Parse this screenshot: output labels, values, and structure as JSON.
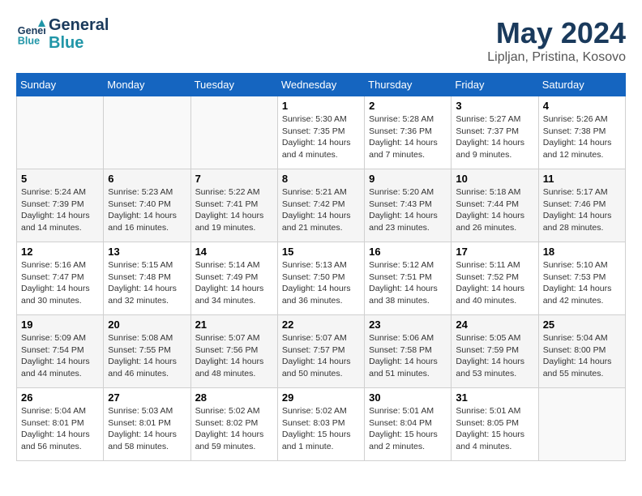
{
  "header": {
    "logo_line1": "General",
    "logo_line2": "Blue",
    "title": "May 2024",
    "subtitle": "Lipljan, Pristina, Kosovo"
  },
  "weekdays": [
    "Sunday",
    "Monday",
    "Tuesday",
    "Wednesday",
    "Thursday",
    "Friday",
    "Saturday"
  ],
  "weeks": [
    [
      {
        "day": "",
        "info": ""
      },
      {
        "day": "",
        "info": ""
      },
      {
        "day": "",
        "info": ""
      },
      {
        "day": "1",
        "info": "Sunrise: 5:30 AM\nSunset: 7:35 PM\nDaylight: 14 hours\nand 4 minutes."
      },
      {
        "day": "2",
        "info": "Sunrise: 5:28 AM\nSunset: 7:36 PM\nDaylight: 14 hours\nand 7 minutes."
      },
      {
        "day": "3",
        "info": "Sunrise: 5:27 AM\nSunset: 7:37 PM\nDaylight: 14 hours\nand 9 minutes."
      },
      {
        "day": "4",
        "info": "Sunrise: 5:26 AM\nSunset: 7:38 PM\nDaylight: 14 hours\nand 12 minutes."
      }
    ],
    [
      {
        "day": "5",
        "info": "Sunrise: 5:24 AM\nSunset: 7:39 PM\nDaylight: 14 hours\nand 14 minutes."
      },
      {
        "day": "6",
        "info": "Sunrise: 5:23 AM\nSunset: 7:40 PM\nDaylight: 14 hours\nand 16 minutes."
      },
      {
        "day": "7",
        "info": "Sunrise: 5:22 AM\nSunset: 7:41 PM\nDaylight: 14 hours\nand 19 minutes."
      },
      {
        "day": "8",
        "info": "Sunrise: 5:21 AM\nSunset: 7:42 PM\nDaylight: 14 hours\nand 21 minutes."
      },
      {
        "day": "9",
        "info": "Sunrise: 5:20 AM\nSunset: 7:43 PM\nDaylight: 14 hours\nand 23 minutes."
      },
      {
        "day": "10",
        "info": "Sunrise: 5:18 AM\nSunset: 7:44 PM\nDaylight: 14 hours\nand 26 minutes."
      },
      {
        "day": "11",
        "info": "Sunrise: 5:17 AM\nSunset: 7:46 PM\nDaylight: 14 hours\nand 28 minutes."
      }
    ],
    [
      {
        "day": "12",
        "info": "Sunrise: 5:16 AM\nSunset: 7:47 PM\nDaylight: 14 hours\nand 30 minutes."
      },
      {
        "day": "13",
        "info": "Sunrise: 5:15 AM\nSunset: 7:48 PM\nDaylight: 14 hours\nand 32 minutes."
      },
      {
        "day": "14",
        "info": "Sunrise: 5:14 AM\nSunset: 7:49 PM\nDaylight: 14 hours\nand 34 minutes."
      },
      {
        "day": "15",
        "info": "Sunrise: 5:13 AM\nSunset: 7:50 PM\nDaylight: 14 hours\nand 36 minutes."
      },
      {
        "day": "16",
        "info": "Sunrise: 5:12 AM\nSunset: 7:51 PM\nDaylight: 14 hours\nand 38 minutes."
      },
      {
        "day": "17",
        "info": "Sunrise: 5:11 AM\nSunset: 7:52 PM\nDaylight: 14 hours\nand 40 minutes."
      },
      {
        "day": "18",
        "info": "Sunrise: 5:10 AM\nSunset: 7:53 PM\nDaylight: 14 hours\nand 42 minutes."
      }
    ],
    [
      {
        "day": "19",
        "info": "Sunrise: 5:09 AM\nSunset: 7:54 PM\nDaylight: 14 hours\nand 44 minutes."
      },
      {
        "day": "20",
        "info": "Sunrise: 5:08 AM\nSunset: 7:55 PM\nDaylight: 14 hours\nand 46 minutes."
      },
      {
        "day": "21",
        "info": "Sunrise: 5:07 AM\nSunset: 7:56 PM\nDaylight: 14 hours\nand 48 minutes."
      },
      {
        "day": "22",
        "info": "Sunrise: 5:07 AM\nSunset: 7:57 PM\nDaylight: 14 hours\nand 50 minutes."
      },
      {
        "day": "23",
        "info": "Sunrise: 5:06 AM\nSunset: 7:58 PM\nDaylight: 14 hours\nand 51 minutes."
      },
      {
        "day": "24",
        "info": "Sunrise: 5:05 AM\nSunset: 7:59 PM\nDaylight: 14 hours\nand 53 minutes."
      },
      {
        "day": "25",
        "info": "Sunrise: 5:04 AM\nSunset: 8:00 PM\nDaylight: 14 hours\nand 55 minutes."
      }
    ],
    [
      {
        "day": "26",
        "info": "Sunrise: 5:04 AM\nSunset: 8:01 PM\nDaylight: 14 hours\nand 56 minutes."
      },
      {
        "day": "27",
        "info": "Sunrise: 5:03 AM\nSunset: 8:01 PM\nDaylight: 14 hours\nand 58 minutes."
      },
      {
        "day": "28",
        "info": "Sunrise: 5:02 AM\nSunset: 8:02 PM\nDaylight: 14 hours\nand 59 minutes."
      },
      {
        "day": "29",
        "info": "Sunrise: 5:02 AM\nSunset: 8:03 PM\nDaylight: 15 hours\nand 1 minute."
      },
      {
        "day": "30",
        "info": "Sunrise: 5:01 AM\nSunset: 8:04 PM\nDaylight: 15 hours\nand 2 minutes."
      },
      {
        "day": "31",
        "info": "Sunrise: 5:01 AM\nSunset: 8:05 PM\nDaylight: 15 hours\nand 4 minutes."
      },
      {
        "day": "",
        "info": ""
      }
    ]
  ]
}
